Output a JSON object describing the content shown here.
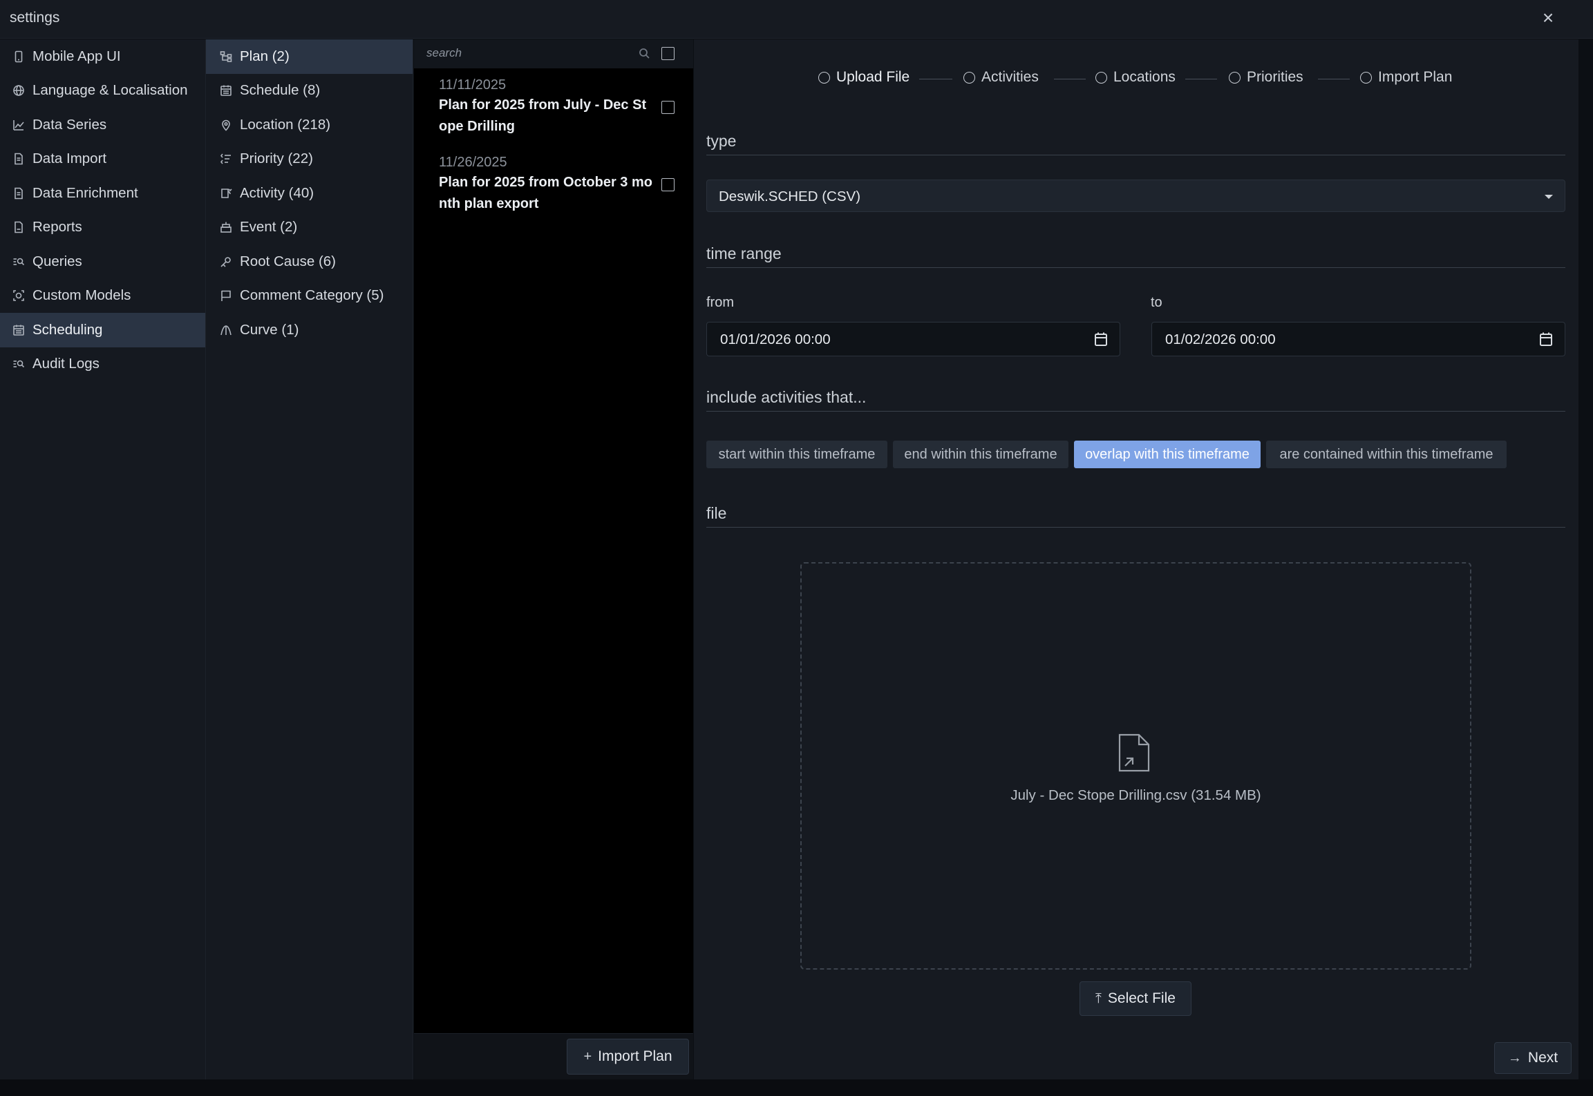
{
  "window": {
    "title": "settings",
    "close_label": "×"
  },
  "nav_primary": [
    {
      "label": "Mobile App UI",
      "icon": "phone-icon"
    },
    {
      "label": "Language & Localisation",
      "icon": "globe-icon"
    },
    {
      "label": "Data Series",
      "icon": "line-chart-icon"
    },
    {
      "label": "Data Import",
      "icon": "document-icon"
    },
    {
      "label": "Data Enrichment",
      "icon": "document-icon"
    },
    {
      "label": "Reports",
      "icon": "report-icon"
    },
    {
      "label": "Queries",
      "icon": "query-icon"
    },
    {
      "label": "Custom Models",
      "icon": "models-icon"
    },
    {
      "label": "Scheduling",
      "icon": "calendar-icon",
      "active": true
    },
    {
      "label": "Audit Logs",
      "icon": "query-icon"
    }
  ],
  "nav_secondary": [
    {
      "label": "Plan (2)",
      "icon": "plan-icon",
      "active": true
    },
    {
      "label": "Schedule (8)",
      "icon": "calendar-icon"
    },
    {
      "label": "Location (218)",
      "icon": "location-pin-icon"
    },
    {
      "label": "Priority (22)",
      "icon": "priority-icon"
    },
    {
      "label": "Activity (40)",
      "icon": "activity-icon"
    },
    {
      "label": "Event (2)",
      "icon": "event-icon"
    },
    {
      "label": "Root Cause (6)",
      "icon": "root-cause-icon"
    },
    {
      "label": "Comment Category (5)",
      "icon": "comment-flag-icon"
    },
    {
      "label": "Curve (1)",
      "icon": "curve-icon"
    }
  ],
  "plan_list": {
    "search_placeholder": "search",
    "items": [
      {
        "date": "11/11/2025",
        "title": "Plan for 2025 from July - Dec Stope Drilling"
      },
      {
        "date": "11/26/2025",
        "title": "Plan for 2025 from October 3 month plan export"
      }
    ],
    "import_button": "Import Plan"
  },
  "wizard": {
    "steps": [
      "Upload File",
      "Activities",
      "Locations",
      "Priorities",
      "Import Plan"
    ],
    "type_heading": "type",
    "type_value": "Deswik.SCHED (CSV)",
    "time_range_heading": "time range",
    "from_label": "from",
    "from_value": "01/01/2026 00:00",
    "to_label": "to",
    "to_value": "01/02/2026 00:00",
    "include_heading": "include activities that...",
    "include_options": [
      {
        "label": "start within this timeframe"
      },
      {
        "label": "end within this timeframe"
      },
      {
        "label": "overlap with this timeframe",
        "selected": true
      },
      {
        "label": "are contained within this timeframe"
      }
    ],
    "file_heading": "file",
    "file_name": "July - Dec Stope Drilling.csv (31.54 MB)",
    "select_file_button": "Select File",
    "next_button": "Next"
  },
  "colors": {
    "accent": "#7ea3e6",
    "panel": "#151920",
    "list_bg": "#000000",
    "active_nav": "#2a3444"
  }
}
